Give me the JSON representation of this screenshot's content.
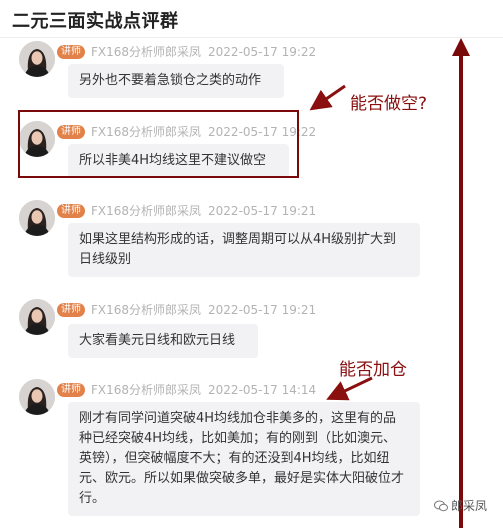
{
  "header": {
    "title": "二元三面实战点评群"
  },
  "messages": [
    {
      "role_badge": "讲师",
      "author": "FX168分析师郎采凤",
      "time": "2022-05-17 19:22",
      "text": "另外也不要着急锁仓之类的动作"
    },
    {
      "role_badge": "讲师",
      "author": "FX168分析师郎采凤",
      "time": "2022-05-17 19:22",
      "text": "所以非美4H均线这里不建议做空"
    },
    {
      "role_badge": "讲师",
      "author": "FX168分析师郎采凤",
      "time": "2022-05-17 19:21",
      "text": "如果这里结构形成的话，调整周期可以从4H级别扩大到日线级别"
    },
    {
      "role_badge": "讲师",
      "author": "FX168分析师郎采凤",
      "time": "2022-05-17 19:21",
      "text": "大家看美元日线和欧元日线"
    },
    {
      "role_badge": "讲师",
      "author": "FX168分析师郎采凤",
      "time": "2022-05-17 14:14",
      "text": "刚才有同学问道突破4H均线加仓非美多的，这里有的品种已经突破4H均线，比如美加；有的刚到（比如澳元、英镑），但突破幅度不大；有的还没到4H均线，比如纽元、欧元。所以如果做突破多单，最好是实体大阳破位才行。"
    }
  ],
  "annotations": {
    "question_short": "能否做空?",
    "question_add": "能否加仓"
  },
  "watermark": {
    "text": "郎采凤"
  },
  "colors": {
    "badge": "#e2824a",
    "annotation": "#8a0f0f",
    "bubble": "#f2f2f5"
  }
}
